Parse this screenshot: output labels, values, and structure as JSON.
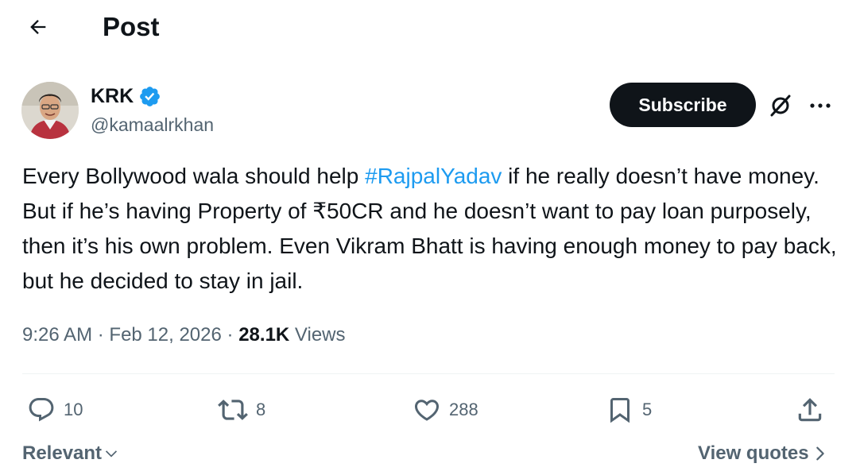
{
  "header": {
    "title": "Post"
  },
  "author": {
    "display_name": "KRK",
    "handle": "@kamaalrkhan",
    "verified": true
  },
  "actions_top": {
    "subscribe_label": "Subscribe"
  },
  "tweet": {
    "text_before": "Every Bollywood wala should help ",
    "hashtag": "#RajpalYadav",
    "text_after": " if he really doesn’t have money. But if he’s having Property of ₹50CR and he doesn’t want to pay loan purposely, then it’s his own problem. Even Vikram Bhatt is having enough money to pay back, but he decided to stay in jail."
  },
  "meta": {
    "time": "9:26 AM",
    "date": "Feb 12, 2026",
    "separator": "·",
    "views_count": "28.1K",
    "views_label": "Views"
  },
  "stats": {
    "replies": "10",
    "reposts": "8",
    "likes": "288",
    "bookmarks": "5"
  },
  "footer": {
    "sort_label": "Relevant",
    "view_quotes_label": "View quotes"
  },
  "colors": {
    "accent": "#1d9bf0",
    "text_primary": "#0f1419",
    "text_secondary": "#536471",
    "button_dark": "#0f1419"
  },
  "icons": [
    "back-arrow-icon",
    "verified-badge-icon",
    "grok-icon",
    "more-icon",
    "reply-icon",
    "repost-icon",
    "like-icon",
    "bookmark-icon",
    "share-icon",
    "chevron-down-icon",
    "chevron-right-icon"
  ]
}
